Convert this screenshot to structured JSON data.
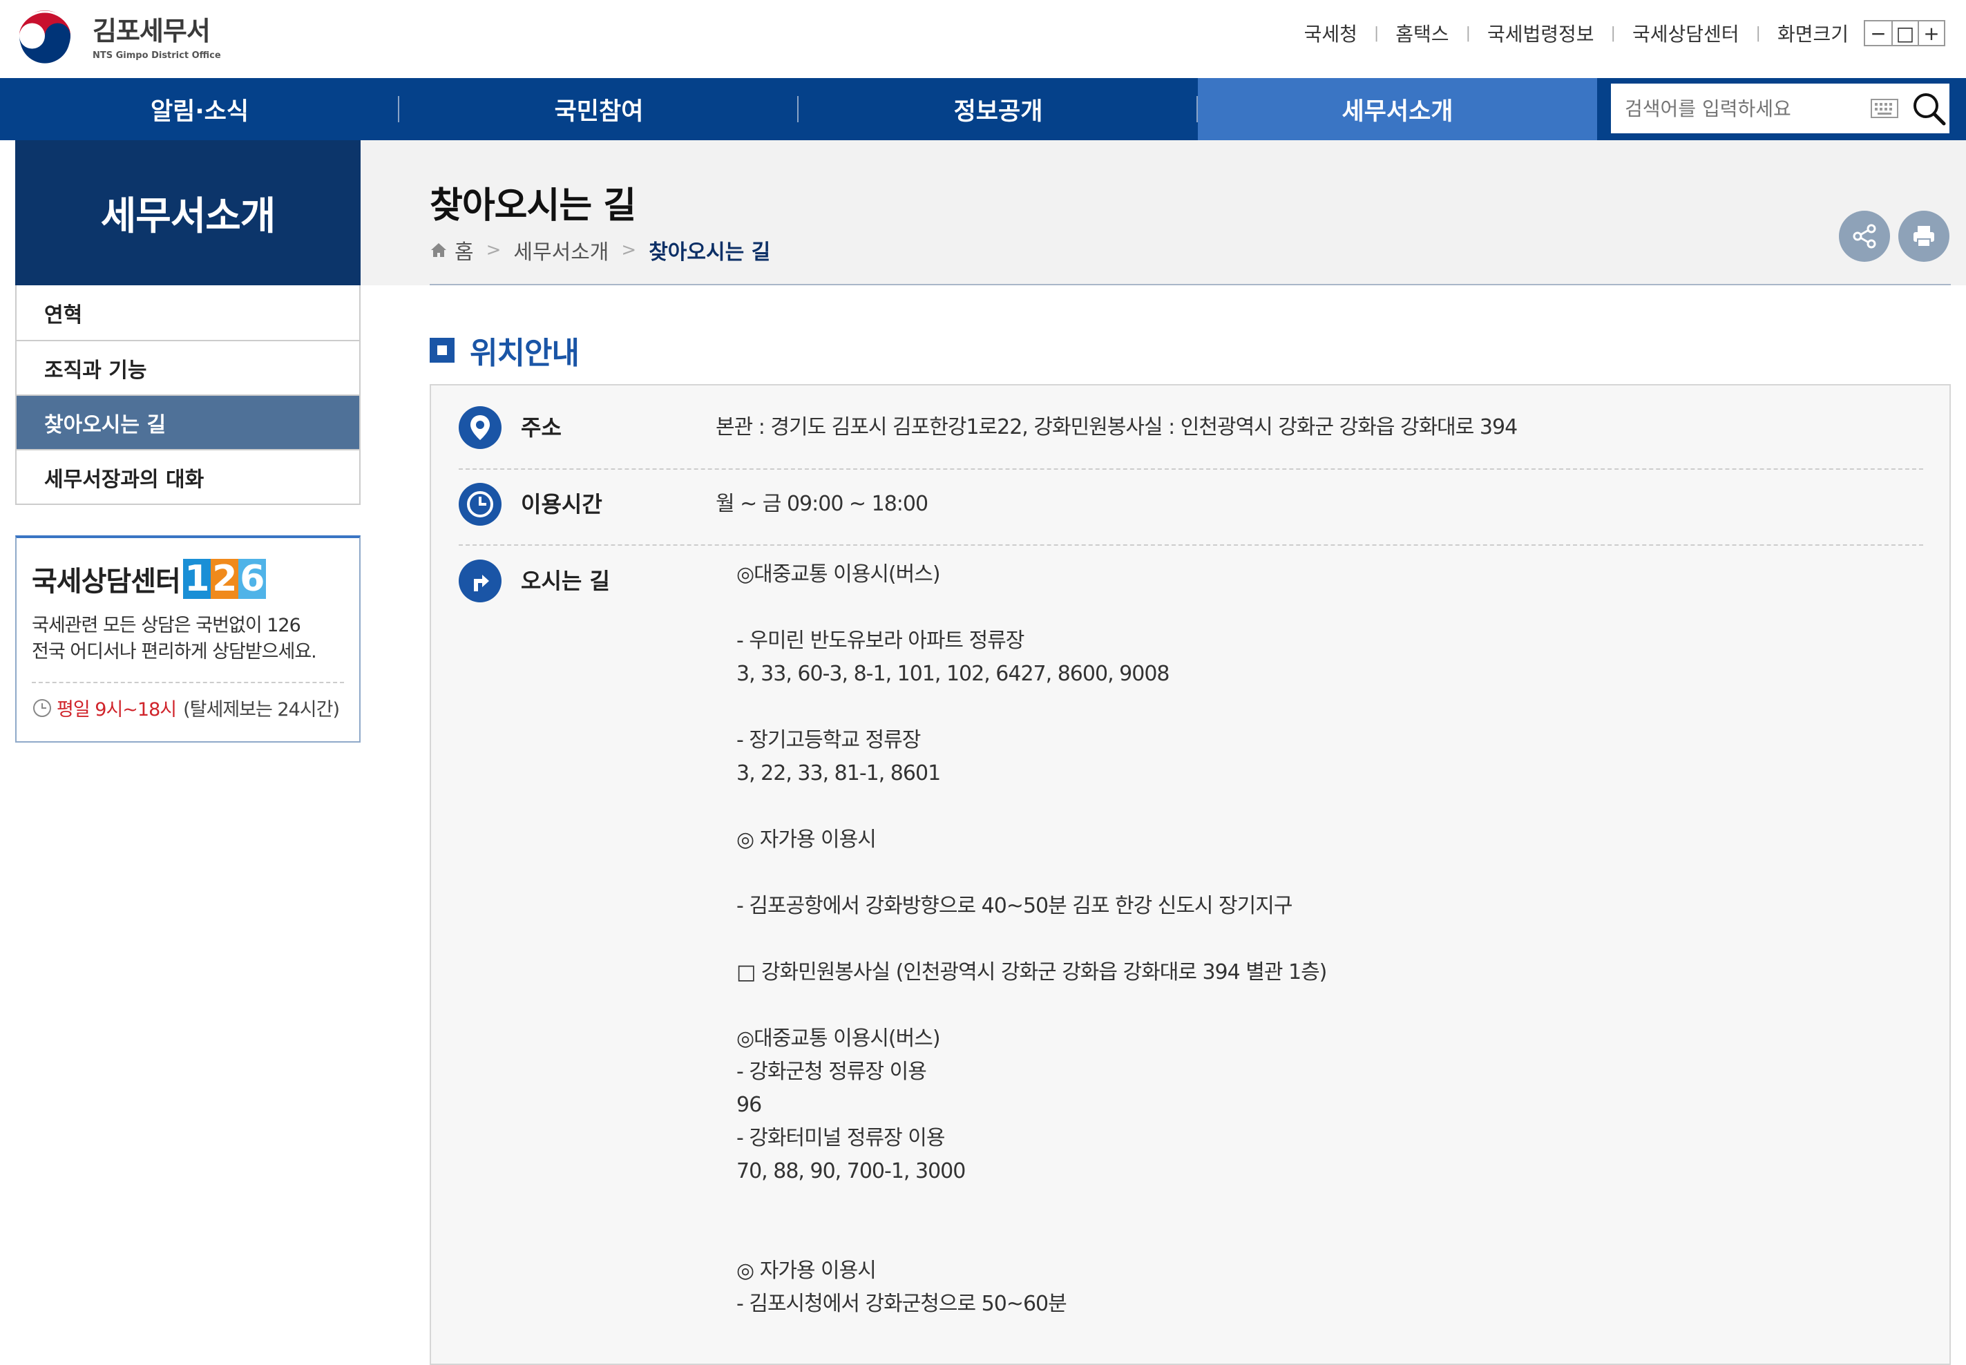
{
  "header": {
    "logo_title": "김포세무서",
    "logo_sub": "NTS Gimpo District Office",
    "util_links": [
      "국세청",
      "홈택스",
      "국세법령정보",
      "국세상담센터",
      "화면크기"
    ],
    "zoom_buttons": [
      "−",
      "□",
      "+"
    ]
  },
  "gnb": {
    "items": [
      "알림·소식",
      "국민참여",
      "정보공개",
      "세무서소개"
    ],
    "active_index": 3,
    "search_placeholder": "검색어를 입력하세요"
  },
  "sidebar": {
    "title": "세무서소개",
    "items": [
      "연혁",
      "조직과 기능",
      "찾아오시는 길",
      "세무서장과의 대화"
    ],
    "active_index": 2,
    "call_center": {
      "title": "국세상담센터",
      "number_digits": [
        "1",
        "2",
        "6"
      ],
      "desc_line1": "국세관련 모든 상담은 국번없이 126",
      "desc_line2": "전국 어디서나 편리하게 상담받으세요.",
      "time_red": "평일 9시~18시",
      "time_gray": "(탈세제보는 24시간)"
    }
  },
  "page": {
    "title": "찾아오시는 길",
    "breadcrumb": [
      "홈",
      "세무서소개",
      "찾아오시는 길"
    ]
  },
  "location": {
    "section_title": "위치안내",
    "address_label": "주소",
    "address_value": "본관 : 경기도 김포시 김포한강1로22, 강화민원봉사실 : 인천광역시 강화군 강화읍 강화대로 394",
    "hours_label": "이용시간",
    "hours_value": "월 ~ 금 09:00 ~ 18:00",
    "directions_label": "오시는 길",
    "directions_lines": [
      "◎대중교통 이용시(버스)",
      "",
      "- 우미린 반도유보라 아파트 정류장",
      "3, 33, 60-3, 8-1, 101, 102, 6427, 8600, 9008",
      "",
      "- 장기고등학교 정류장",
      "3, 22, 33, 81-1, 8601",
      "",
      "◎ 자가용 이용시",
      "",
      "- 김포공항에서 강화방향으로 40~50분 김포 한강 신도시 장기지구",
      "",
      "□ 강화민원봉사실 (인천광역시 강화군 강화읍 강화대로 394 별관 1층)",
      "",
      "◎대중교통 이용시(버스)",
      "- 강화군청 정류장 이용",
      "96",
      "- 강화터미널 정류장 이용",
      "70, 88, 90, 700-1, 3000",
      "",
      "",
      "◎ 자가용 이용시",
      "- 김포시청에서 강화군청으로 50~60분"
    ]
  },
  "colors": {
    "gnb": "#05418a",
    "gnb_active": "#3a75c4",
    "sidebar_head": "#0c356a",
    "lnb_active": "#4f7198",
    "accent": "#1a55a6"
  }
}
